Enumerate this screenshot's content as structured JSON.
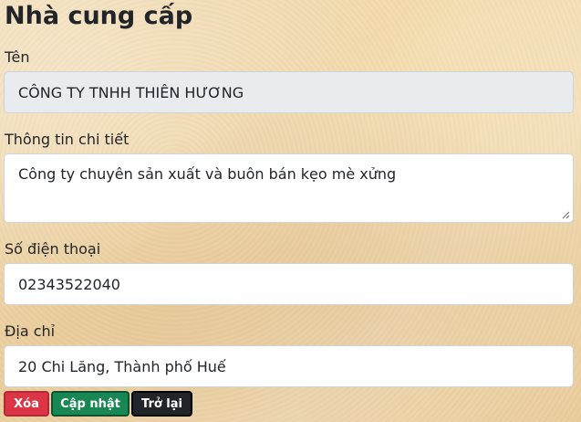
{
  "page": {
    "title": "Nhà cung cấp"
  },
  "form": {
    "name": {
      "label": "Tên",
      "value": "CÔNG TY TNHH THIÊN HƯƠNG"
    },
    "details": {
      "label": "Thông tin chi tiết",
      "value": "Công ty chuyên sản xuất và buôn bán kẹo mè xửng"
    },
    "phone": {
      "label": "Số điện thoại",
      "value": "02343522040"
    },
    "address": {
      "label": "Địa chỉ",
      "value": "20 Chi Lăng, Thành phố Huế"
    }
  },
  "actions": {
    "delete_label": "Xóa",
    "update_label": "Cập nhật",
    "back_label": "Trở lại"
  },
  "colors": {
    "danger": "#dc3545",
    "success": "#198754",
    "dark": "#212529",
    "readonly_bg": "#e9ecef"
  }
}
